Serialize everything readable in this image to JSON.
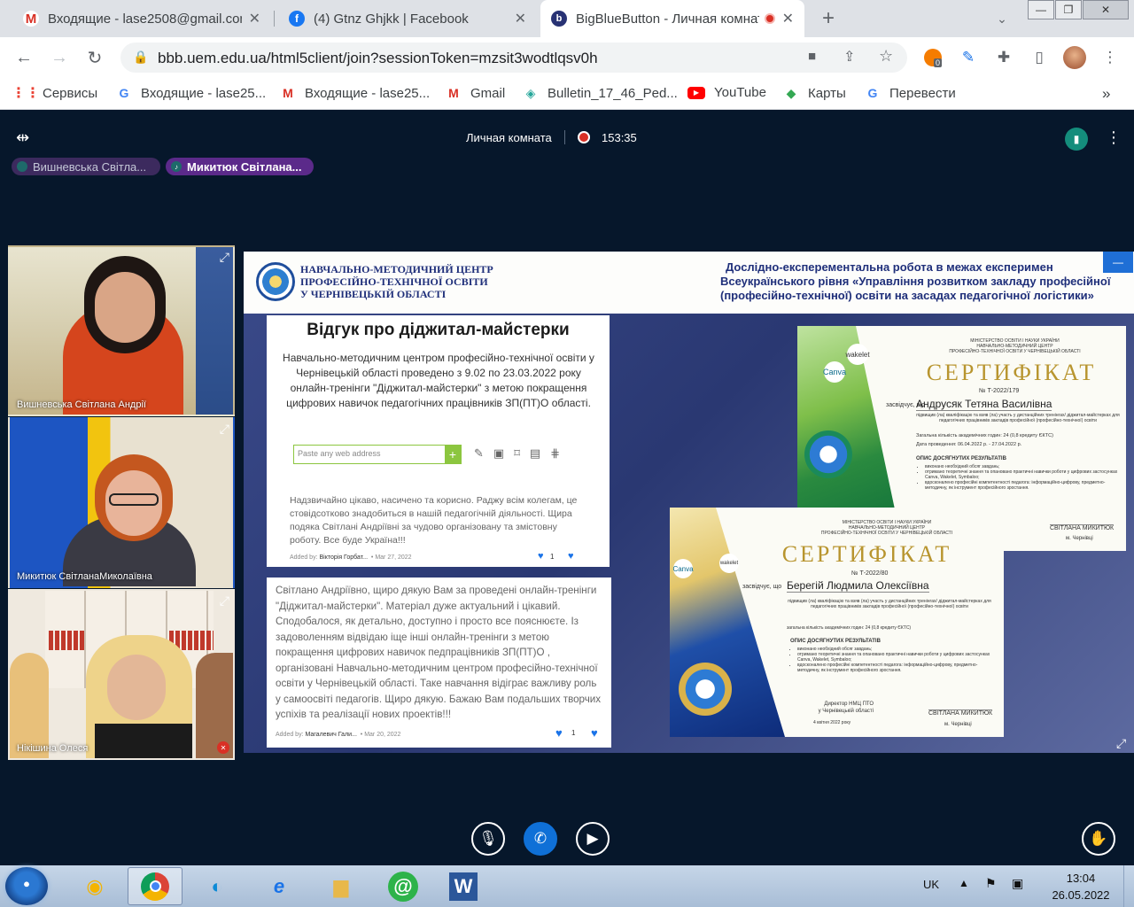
{
  "tabs": [
    {
      "title": "Входящие - lase2508@gmail.com",
      "icon": "gmail-icon"
    },
    {
      "title": "(4) Gtnz Ghjkk | Facebook",
      "icon": "facebook-icon"
    },
    {
      "title": "BigBlueButton - Личная комната",
      "icon": "bigbluebutton-icon"
    }
  ],
  "new_tab": "+",
  "address": {
    "url": "bbb.uem.edu.ua/html5client/join?sessionToken=mzsit3wodtlqsv0h"
  },
  "extension_badge": "0",
  "bookmarks": [
    {
      "label": "Сервисы",
      "icon": "apps-grid-icon"
    },
    {
      "label": "Входящие - lase25...",
      "icon": "google-icon"
    },
    {
      "label": "Входящие - lase25...",
      "icon": "gmail-icon"
    },
    {
      "label": "Gmail",
      "icon": "gmail-icon"
    },
    {
      "label": "Bulletin_17_46_Ped...",
      "icon": "bulletin-icon"
    },
    {
      "label": "YouTube",
      "icon": "youtube-icon"
    },
    {
      "label": "Карты",
      "icon": "maps-icon"
    },
    {
      "label": "Перевести",
      "icon": "translate-icon"
    }
  ],
  "bookmarks_more": "»",
  "meeting": {
    "title": "Личная комната",
    "timer": "153:35"
  },
  "talkers": [
    "Вишневська Світла...",
    "Микитюк Світлана..."
  ],
  "videos": [
    {
      "name": "Вишневська Світлана Андрії"
    },
    {
      "name": "Микитюк СвітланаМиколаївна"
    },
    {
      "name": "Нікішина Олеся"
    }
  ],
  "slide": {
    "org_line1": "НАВЧАЛЬНО-МЕТОДИЧНИЙ ЦЕНТР",
    "org_line2": "ПРОФЕСІЙНО-ТЕХНІЧНОЇ ОСВІТИ",
    "org_line3": "У ЧЕРНІВЕЦЬКІЙ ОБЛАСТІ",
    "header_line1": "Дослідно-експерементальна робота в межах експеримен",
    "header_line2": "Всеукраїнського рівня «Управління розвитком закладу професійної",
    "header_line3": "(професійно-технічної) освіти на засадах педагогічної логістики»",
    "card1_title": "Відгук про діджитал-майстерки",
    "card1_intro": "Навчально-методичним центром професійно-технічної освіти у Чернівецькій області  проведено з 9.02 по 23.03.2022 року онлайн-тренінги \"Діджитал-майстерки\" з метою покращення цифрових навичок педагогічних працівників ЗП(ПТ)О області.",
    "paste_placeholder": "Paste any web address",
    "comment1": "Надзвичайно цікаво, насичено та корисно. Раджу всім колегам, це стовідсотково знадобиться в нашій педагогічній діяльності. Щира подяка Світлані Андріївні за чудово організовану та змістовну роботу. Все буде Україна!!!",
    "comment1_added": "Added by:",
    "comment1_author": "Вікторія Горбат...",
    "comment1_date": "Mar 27, 2022",
    "comment1_likes": "1",
    "comment2": "Світлано Андріївно, щиро дякую Вам за проведені онлайн-тренінги \"Діджитал-майстерки\". Матеріал дуже актуальний і цікавий. Сподобалося, як детально, доступно і просто все пояснюєте. Із задоволенням відвідаю іще інші онлайн-тренінги з метою покращення цифрових навичок педпрацівників ЗП(ПТ)О , організовані Навчально-методичним центром професійно-технічної освіти у Чернівецькій області. Таке навчання відіграє важливу роль у самоосвіті педагогів. Щиро дякую. Бажаю Вам подальших творчих успіхів та реалізації нових проектів!!!",
    "comment2_added": "Added by:",
    "comment2_author": "Магалевич Гали...",
    "comment2_date": "Mar 20, 2022",
    "comment2_likes": "1",
    "cert_ministry": "МІНІСТЕРСТВО ОСВІТИ І НАУКИ УКРАЇНИ",
    "cert_center1": "НАВЧАЛЬНО-МЕТОДИЧНИЙ ЦЕНТР",
    "cert_center2": "ПРОФЕСІЙНО-ТЕХНІЧНОЇ ОСВІТИ У ЧЕРНІВЕЦЬКІЙ ОБЛАСТІ",
    "cert_title": "СЕРТИФІКАТ",
    "cert1_number": "№  Т-2022/179",
    "cert1_certifies": "засвідчує, що",
    "cert1_name": "Андрусяк Тетяна Василівна",
    "cert1_text": "підвищив (ла) кваліфікацію та взяв (ла) участь у дистанційних тренінгах/ діджитал-майстерках для педагогічних працівників закладів професійної (професійно-технічної) освіти",
    "cert1_hours": "Загальна кількість академічних годин: 24 (0,8 кредиту ЄКТС)",
    "cert1_dates": "Дата проведення: 06.04.2022 р. - 27.04.2022 р.",
    "cert_results_title": "ОПИС ДОСЯГНУТИХ РЕЗУЛЬТАТІВ",
    "cert_result1": "виконано необхідний обсяг завдань;",
    "cert_result2": "отримано теоретичні знання та опановано практичні навички роботи у цифрових застосунках Canva, Wakelet, Symbaloo;",
    "cert_result3": "вдосконалено професійні компетентності педагога: інформаційно-цифрову, предметно-методичну, як інструмент професійного зростання.",
    "cert_signer": "СВІТЛАНА МИКИТЮК",
    "cert_city": "м. Чернівці",
    "cert2_number": "№  Т-2022/80",
    "cert2_certifies": "засвідчує, що",
    "cert2_name": "Берегій Людмила Олексіївна",
    "cert2_text": "підвищив (ла) кваліфікацію та взяв (ла) участь у дистанційних тренінгах/ діджитал-майстерках для педагогічних працівників закладів професійної (професійно-технічної) освіти",
    "cert2_hours": "загальна кількість академічних годин: 24 (0,8 кредиту ЄКТС)",
    "cert2_director1": "Директор НМЦ ПТО",
    "cert2_director2": "у Чернівецькій області",
    "cert2_date": "4 квітня 2022 року",
    "canva": "Canva",
    "wakelet": "wakelet",
    "minimize": "—"
  },
  "taskbar": {
    "lang": "UK",
    "time": "13:04",
    "date": "26.05.2022"
  }
}
